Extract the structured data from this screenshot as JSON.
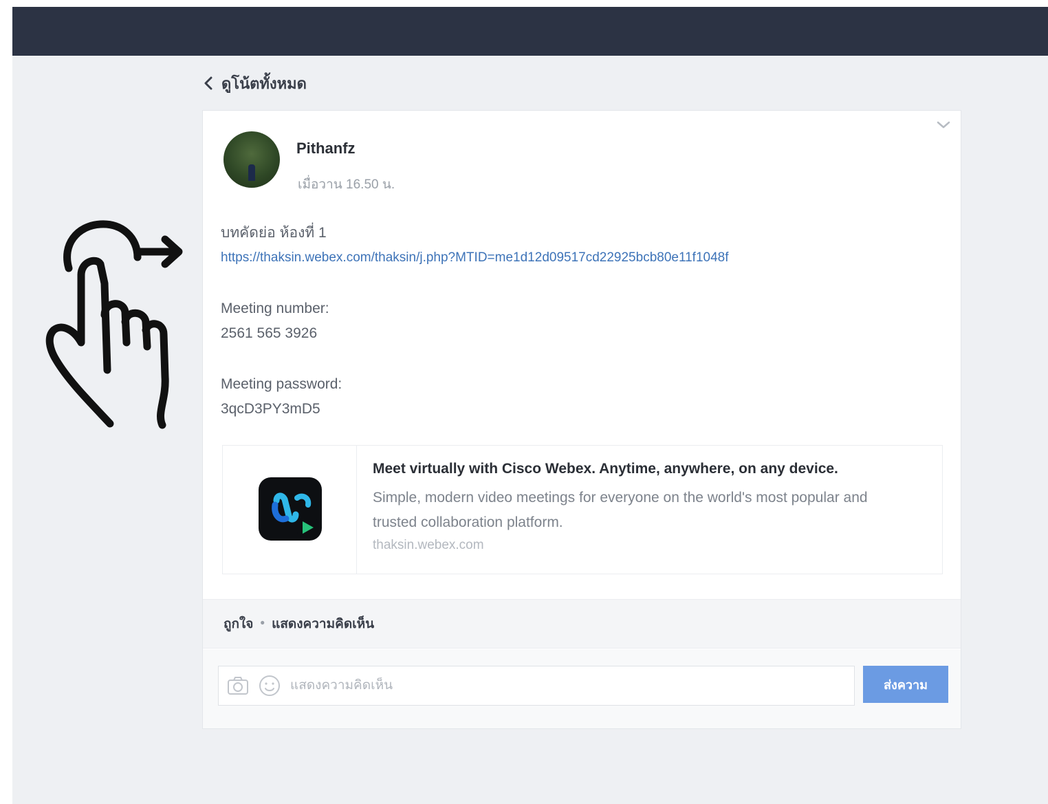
{
  "header": {
    "back_label": "ดูโน้ตทั้งหมด"
  },
  "post": {
    "author": "Pithanfz",
    "time": "เมื่อวาน 16.50 น.",
    "lines": {
      "heading": "บทคัดย่อ ห้องที่ 1",
      "url": "https://thaksin.webex.com/thaksin/j.php?MTID=me1d12d09517cd22925bcb80e11f1048f",
      "meeting_number_label": "Meeting number:",
      "meeting_number": "2561 565 3926",
      "meeting_password_label": "Meeting password:",
      "meeting_password": "3qcD3PY3mD5"
    },
    "preview": {
      "title": "Meet virtually with Cisco Webex. Anytime, anywhere, on any device.",
      "description": "Simple, modern video meetings for everyone on the world's most popular and trusted collaboration platform.",
      "domain": "thaksin.webex.com"
    }
  },
  "reactions": {
    "like_label": "ถูกใจ",
    "separator": "•",
    "comment_label": "แสดงความคิดเห็น"
  },
  "comment_box": {
    "placeholder": "แสดงความคิดเห็น",
    "submit_label": "ส่งความ"
  },
  "icons": {
    "back": "chevron-left-icon",
    "collapse": "chevron-down-icon",
    "camera": "camera-icon",
    "emoji": "emoji-icon",
    "swipe": "swipe-hand-icon"
  },
  "colors": {
    "topbar": "#2c3344",
    "background": "#eef0f3",
    "link": "#3d73b8",
    "submit_button": "#6b9be3"
  }
}
